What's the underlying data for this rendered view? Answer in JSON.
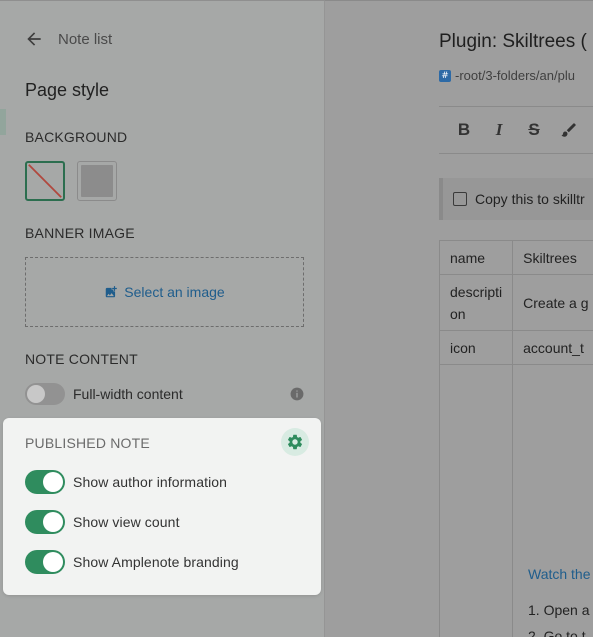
{
  "sidebar": {
    "back_label": "Note list",
    "heading": "Page style",
    "background_label": "BACKGROUND",
    "banner_label": "BANNER IMAGE",
    "select_image": "Select an image",
    "note_content_label": "NOTE CONTENT",
    "full_width_label": "Full-width content",
    "full_width_on": false
  },
  "published": {
    "title": "PUBLISHED NOTE",
    "toggles": [
      {
        "label": "Show author information",
        "on": true
      },
      {
        "label": "Show view count",
        "on": true
      },
      {
        "label": "Show Amplenote branding",
        "on": true
      }
    ]
  },
  "editor": {
    "title": "Plugin: Skiltrees (",
    "path": "-root/3-folders/an/plu",
    "callout": "Copy this to skilltr",
    "table": [
      [
        "name",
        "Skiltrees"
      ],
      [
        "descripti on",
        "Create a g"
      ],
      [
        "icon",
        "account_t"
      ]
    ],
    "watch_link": "Watch the",
    "list_item_1": "1.  Open a",
    "list_item_2": "2.  Go to t"
  },
  "colors": {
    "accent": "#2f8c5e",
    "link": "#1f5d8c",
    "card_bg": "#f2f3f2",
    "gear_bg": "#d8ebe2"
  }
}
